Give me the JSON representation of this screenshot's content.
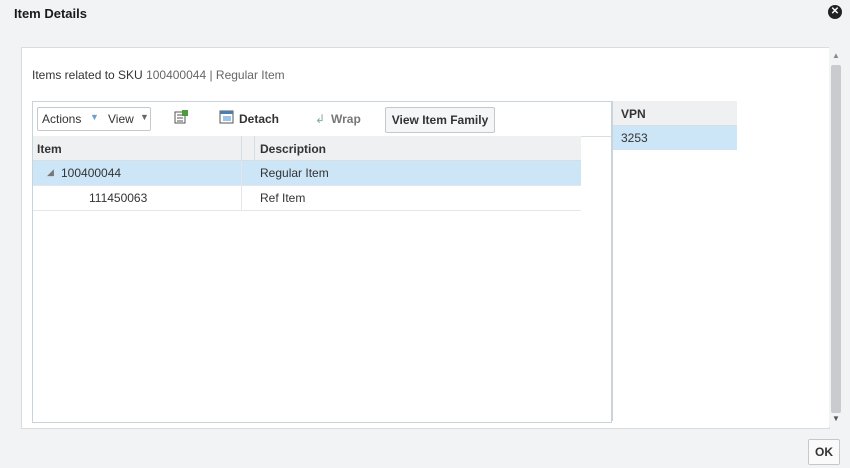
{
  "dialog": {
    "title": "Item Details",
    "close_icon_glyph": "✕",
    "sku_prefix": "Items related to SKU",
    "sku_value": "100400044 | Regular Item",
    "ok_label": "OK"
  },
  "toolbar": {
    "actions_label": "Actions",
    "view_label": "View",
    "export_icon": "export-to-excel-icon",
    "detach_label": "Detach",
    "wrap_label": "Wrap",
    "view_family_label": "View Item Family"
  },
  "table": {
    "columns": [
      "Item",
      "Description"
    ],
    "rows": [
      {
        "item": "100400044",
        "description": "Regular Item",
        "expanded": true,
        "selected": true
      },
      {
        "item": "111450063",
        "description": "Ref Item",
        "expanded": false,
        "selected": false
      }
    ]
  },
  "vpn": {
    "header": "VPN",
    "rows": [
      "3253"
    ]
  },
  "colors": {
    "selected_row": "#cde6f7",
    "header_bg": "#eef0f2",
    "accent": "#6b9fd1"
  }
}
